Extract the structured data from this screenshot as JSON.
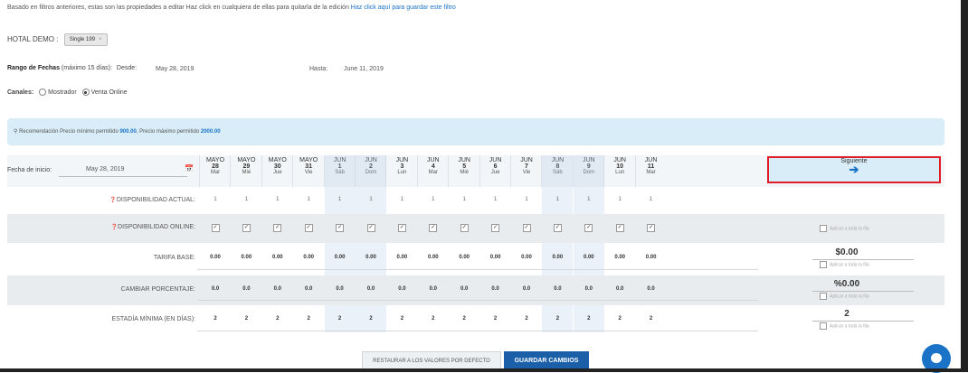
{
  "notice": {
    "text": "Basado en filtros anteriores, estas son las propiedades a editar Haz click en cualquiera de ellas para quitarla de la edición",
    "link": "Haz click aquí para guardar este filtro"
  },
  "hotel": {
    "label": "HOTAL DEMO :",
    "tag": "Single 199",
    "tag_close": "×"
  },
  "dates": {
    "label_bold": "Rango de Fechas",
    "label_hint": "(máximo 15 días):",
    "from_label": "Desde:",
    "from_value": "May 28, 2019",
    "to_label": "Hasta:",
    "to_value": "June 11, 2019"
  },
  "channels": {
    "label": "Canales:",
    "options": [
      "Mostrador",
      "Venta Online"
    ],
    "selected": "Venta Online"
  },
  "recommendation": {
    "icon": "lightbulb-icon",
    "prefix": "Recomendación Precio mínimo permitido",
    "min": "900.00",
    "middle": ", Precio máximo permitido",
    "max": "2000.00"
  },
  "grid": {
    "start_label": "Fecha de inicio:",
    "start_value": "May 28, 2019",
    "calendar_icon": "calendar-icon",
    "next_label": "Siguiente",
    "next_icon": "arrow-right-icon",
    "columns": [
      {
        "month": "MAYO",
        "day": "28",
        "weekday": "Mar",
        "weekend": false
      },
      {
        "month": "MAYO",
        "day": "29",
        "weekday": "Mié",
        "weekend": false
      },
      {
        "month": "MAYO",
        "day": "30",
        "weekday": "Jue",
        "weekend": false
      },
      {
        "month": "MAYO",
        "day": "31",
        "weekday": "Vie",
        "weekend": false
      },
      {
        "month": "JUN",
        "day": "1",
        "weekday": "Sáb",
        "weekend": true
      },
      {
        "month": "JUN",
        "day": "2",
        "weekday": "Dom",
        "weekend": true
      },
      {
        "month": "JUN",
        "day": "3",
        "weekday": "Lun",
        "weekend": false
      },
      {
        "month": "JUN",
        "day": "4",
        "weekday": "Mar",
        "weekend": false
      },
      {
        "month": "JUN",
        "day": "5",
        "weekday": "Mié",
        "weekend": false
      },
      {
        "month": "JUN",
        "day": "6",
        "weekday": "Jue",
        "weekend": false
      },
      {
        "month": "JUN",
        "day": "7",
        "weekday": "Vie",
        "weekend": false
      },
      {
        "month": "JUN",
        "day": "8",
        "weekday": "Sáb",
        "weekend": true
      },
      {
        "month": "JUN",
        "day": "9",
        "weekday": "Dom",
        "weekend": true
      },
      {
        "month": "JUN",
        "day": "10",
        "weekday": "Lun",
        "weekend": false
      },
      {
        "month": "JUN",
        "day": "11",
        "weekday": "Mar",
        "weekend": false
      }
    ],
    "rows": [
      {
        "key": "avail",
        "label": "DISPONIBILIDAD ACTUAL:",
        "info": true,
        "kind": "text",
        "value": "1",
        "alt": false
      },
      {
        "key": "online",
        "label": "DISPONIBILIDAD ONLINE:",
        "info": true,
        "kind": "check",
        "value": "✓",
        "alt": true,
        "apply": "Aplicar a toda la fila"
      },
      {
        "key": "tarifa",
        "label": "TARIFA BASE:",
        "info": false,
        "kind": "bold",
        "value": "0.00",
        "alt": false,
        "summary": "$0.00",
        "apply": "Aplicar a toda la fila"
      },
      {
        "key": "pct",
        "label": "CAMBIAR PORCENTAJE:",
        "info": false,
        "kind": "bold",
        "value": "0.0",
        "alt": true,
        "summary": "%0.00",
        "apply": "Aplicar a toda la fila"
      },
      {
        "key": "stay",
        "label": "ESTADÍA MÍNIMA (EN DÍAS):",
        "info": false,
        "kind": "bold",
        "value": "2",
        "alt": false,
        "summary": "2",
        "apply": "Aplicar a toda la fila"
      }
    ]
  },
  "footer": {
    "reset_label": "RESTAURAR A LOS VALORES POR DEFECTO",
    "save_label": "GUARDAR CAMBIOS"
  },
  "chat_icon": "chat-bubble-icon",
  "colors": {
    "accent": "#1a73c7",
    "primary_button": "#1a5fa8",
    "highlight_border": "#e11d2a",
    "info_bg": "#d8edf7"
  }
}
